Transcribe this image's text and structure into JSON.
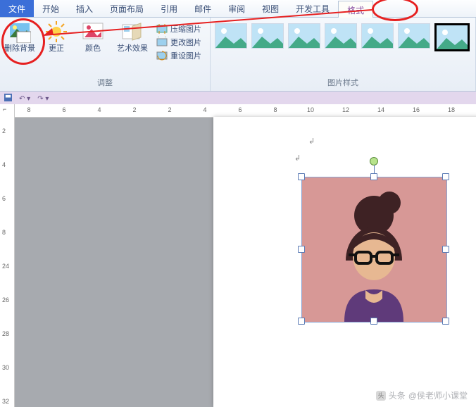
{
  "menubar": {
    "file": "文件",
    "tabs": [
      "开始",
      "插入",
      "页面布局",
      "引用",
      "邮件",
      "审阅",
      "视图",
      "开发工具"
    ],
    "format": "格式"
  },
  "ribbon": {
    "adjust": {
      "label": "调整",
      "remove_bg": "删除背景",
      "corrections": "更正",
      "color": "颜色",
      "artistic": "艺术效果",
      "compress": "压缩图片",
      "change": "更改图片",
      "reset": "重设图片"
    },
    "styles": {
      "label": "图片样式"
    }
  },
  "watermark": {
    "prefix": "头条",
    "author": "@侯老师小课堂"
  },
  "ruler_h": [
    8,
    6,
    4,
    2,
    2,
    4,
    6,
    8,
    10,
    12,
    14,
    16,
    18
  ],
  "ruler_v": [
    2,
    4,
    6,
    8,
    24,
    26,
    28,
    30,
    32
  ]
}
